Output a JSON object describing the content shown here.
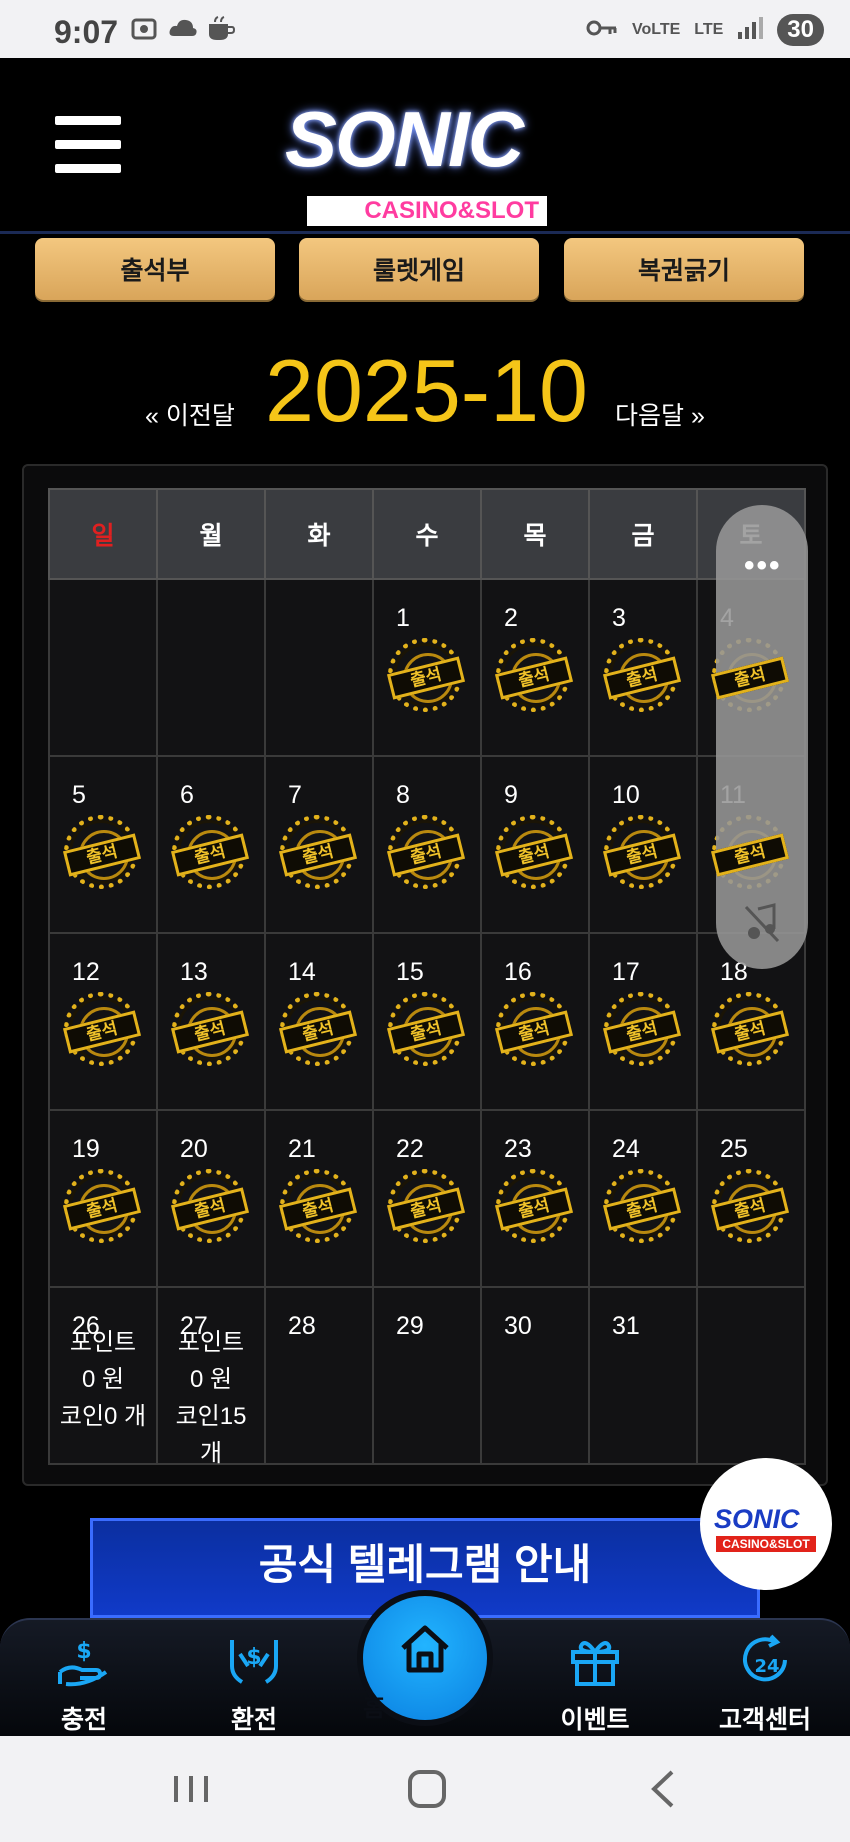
{
  "status_bar": {
    "time": "9:07",
    "battery": "30",
    "network": "LTE"
  },
  "header": {
    "logo_main": "SONIC",
    "logo_sub": "CASINO&SLOT"
  },
  "top_buttons": [
    "출석부",
    "룰렛게임",
    "복권긁기"
  ],
  "month_nav": {
    "prev": "« 이전달",
    "current": "2025-10",
    "next": "다음달 »"
  },
  "calendar": {
    "weekdays": [
      "일",
      "월",
      "화",
      "수",
      "목",
      "금",
      "토"
    ],
    "stamp_label": "출석",
    "weeks": [
      [
        "",
        "",
        "",
        "1",
        "2",
        "3",
        "4"
      ],
      [
        "5",
        "6",
        "7",
        "8",
        "9",
        "10",
        "11"
      ],
      [
        "12",
        "13",
        "14",
        "15",
        "16",
        "17",
        "18"
      ],
      [
        "19",
        "20",
        "21",
        "22",
        "23",
        "24",
        "25"
      ],
      [
        "26",
        "27",
        "28",
        "29",
        "30",
        "31",
        ""
      ]
    ],
    "info_26": {
      "line1": "포인트",
      "line2": "0 원",
      "line3": "코인0 개"
    },
    "info_27": {
      "line1": "포인트",
      "line2": "0 원",
      "line3": "코인15",
      "line4": "개"
    }
  },
  "side_panel": {
    "dots": "•••"
  },
  "badge": {
    "main": "SONIC",
    "sub": "CASINO&SLOT"
  },
  "telegram_banner": {
    "title": "공식 텔레그램 안내"
  },
  "bottom_nav": {
    "charge": "충전",
    "exchange": "환전",
    "home": "홈",
    "event": "이벤트",
    "support": "고객센터"
  },
  "colors": {
    "accent_gold": "#f5c518",
    "home_blue": "#1aa7f5",
    "sunday_red": "#e02020"
  }
}
